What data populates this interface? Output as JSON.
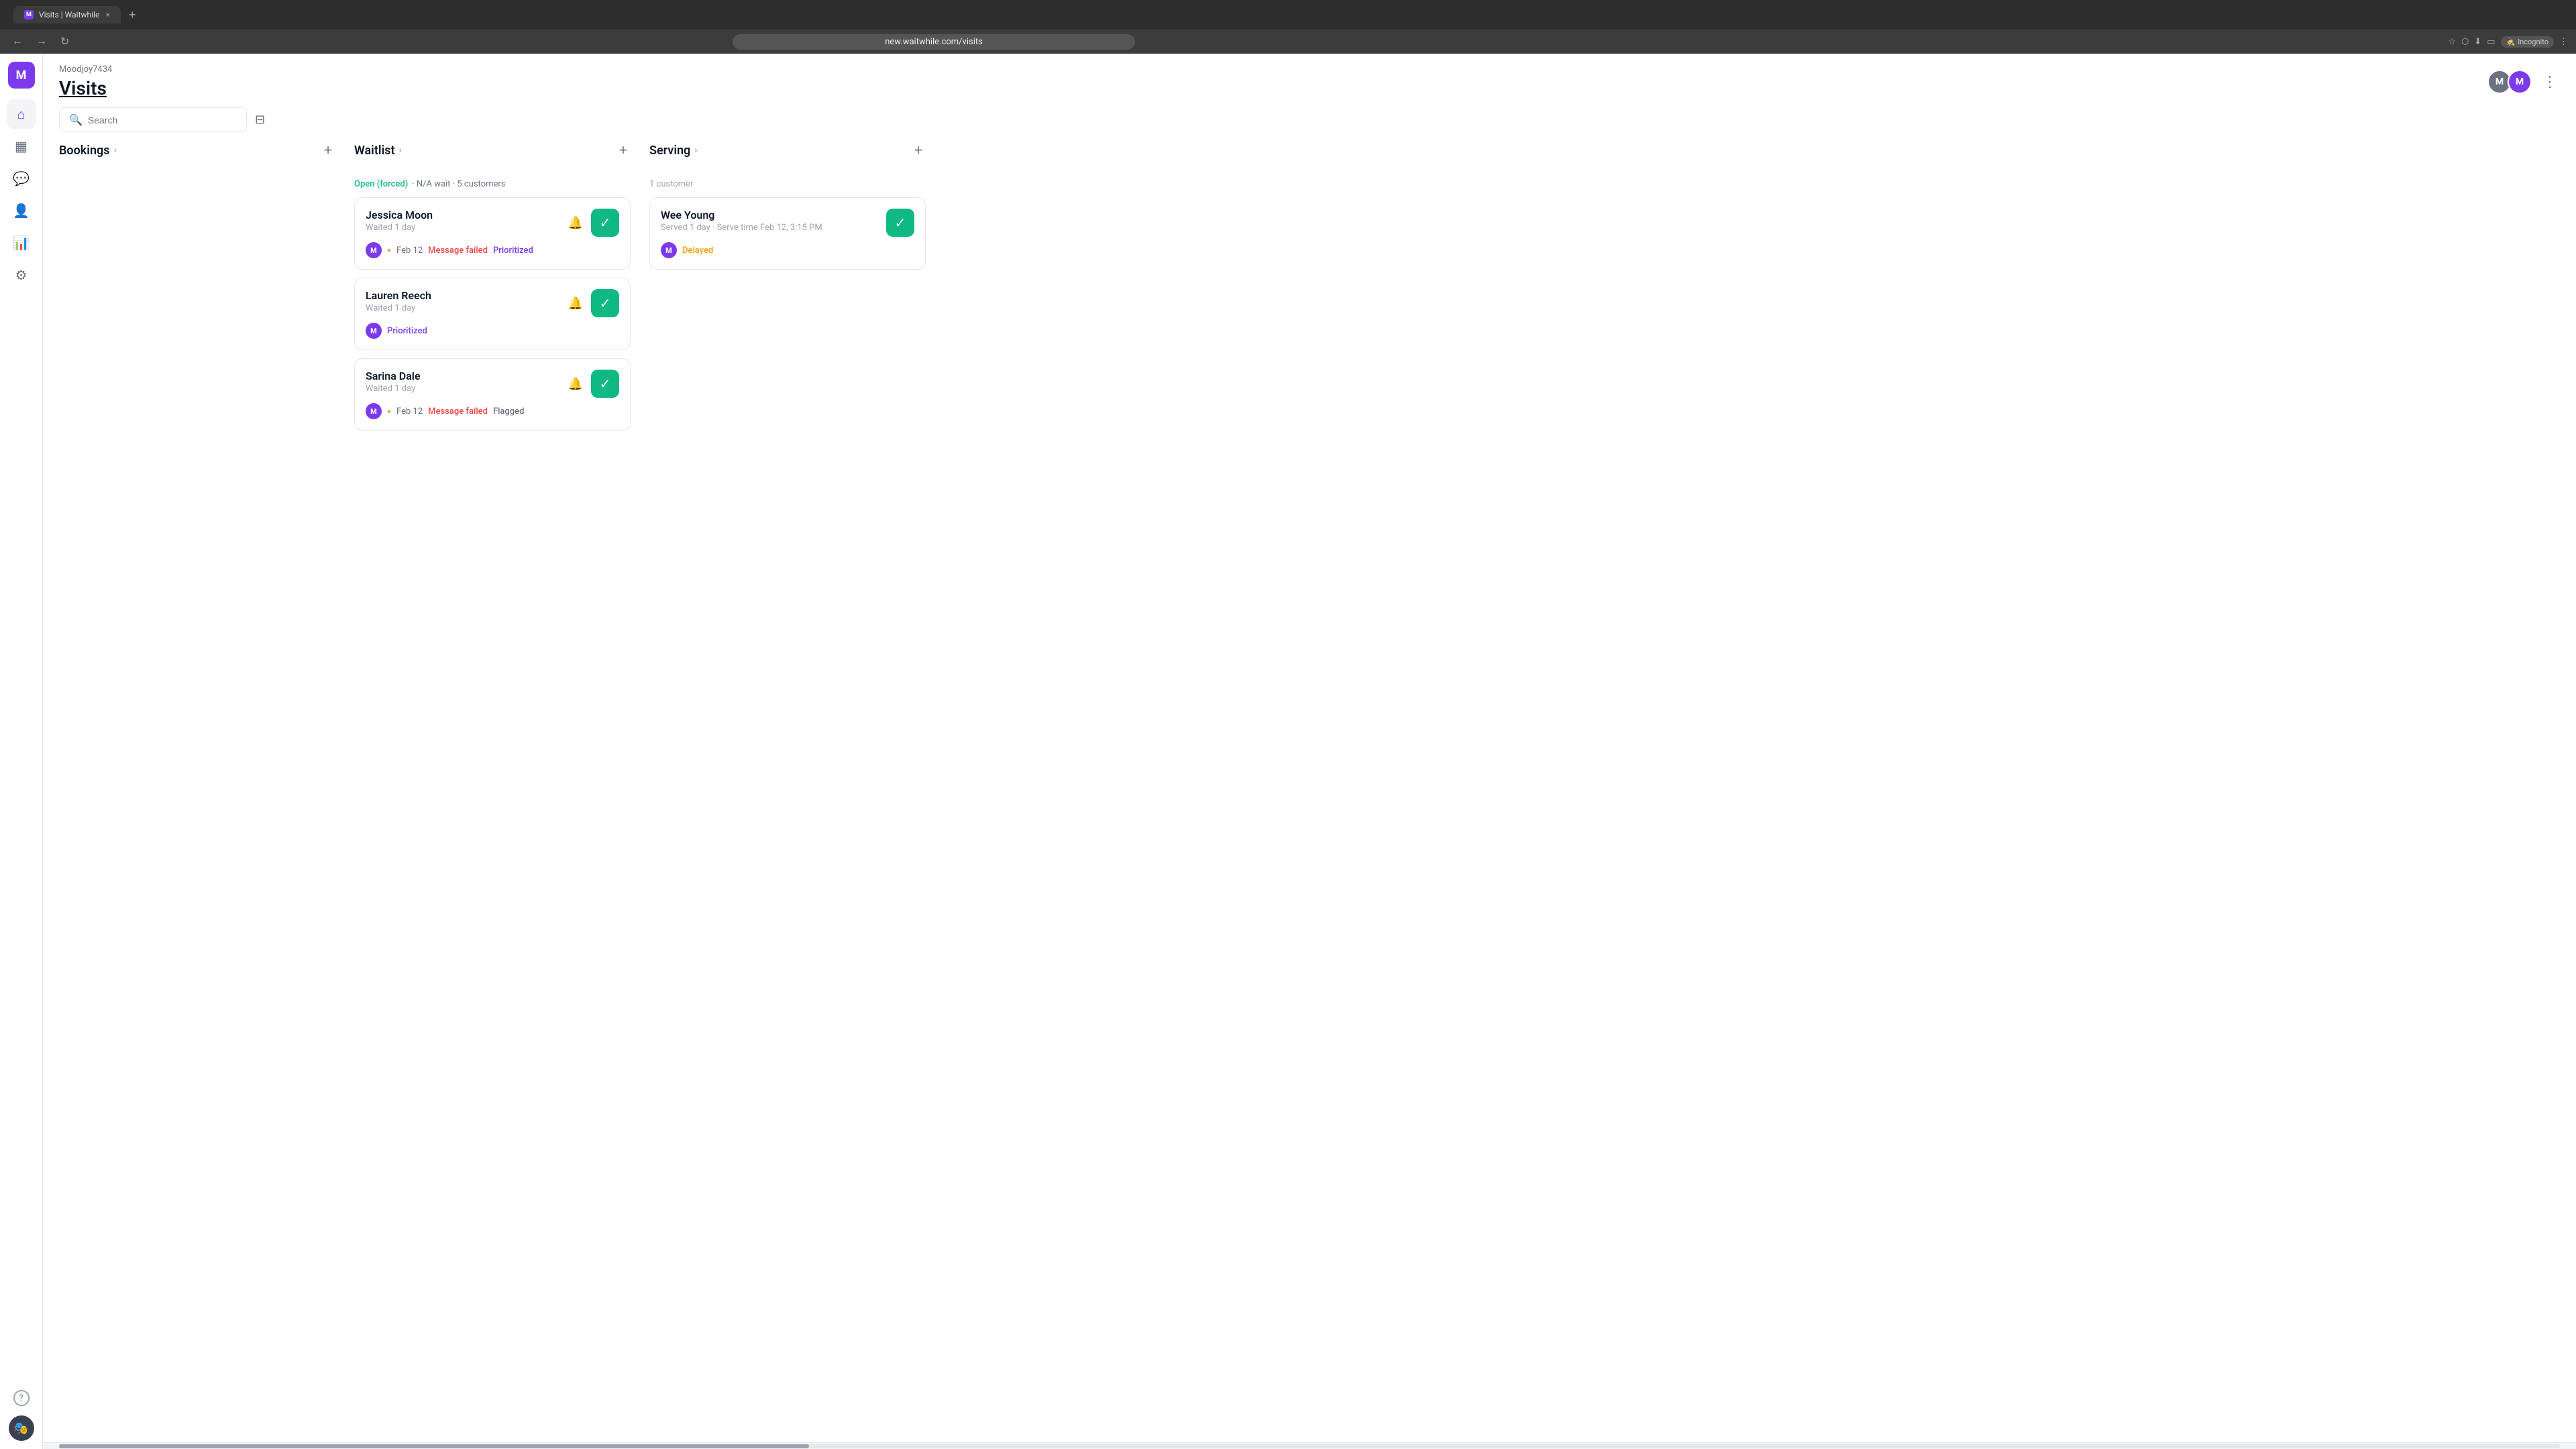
{
  "browser": {
    "tab_favicon": "M",
    "tab_title": "Visits | Waitwhile",
    "tab_close": "×",
    "tab_new": "+",
    "nav_back": "←",
    "nav_forward": "→",
    "nav_refresh": "↻",
    "address": "new.waitwhile.com/visits",
    "incognito_label": "Incognito"
  },
  "sidebar": {
    "logo_letter": "M",
    "items": [
      {
        "icon": "⌂",
        "label": "home-icon",
        "active": true
      },
      {
        "icon": "📅",
        "label": "calendar-icon",
        "active": false
      },
      {
        "icon": "💬",
        "label": "messages-icon",
        "active": false
      },
      {
        "icon": "👤",
        "label": "users-icon",
        "active": false
      },
      {
        "icon": "📊",
        "label": "analytics-icon",
        "active": false
      },
      {
        "icon": "⚙",
        "label": "settings-icon",
        "active": false
      }
    ],
    "help_icon": "?",
    "avatar_text": ""
  },
  "header": {
    "org_name": "Moodjoy7434",
    "page_title": "Visits",
    "avatars": [
      {
        "letter": "M",
        "color": "#6b7280"
      },
      {
        "letter": "M",
        "color": "#7c3aed"
      }
    ],
    "more_icon": "⋮"
  },
  "search": {
    "placeholder": "Search",
    "filter_icon": "⊟"
  },
  "columns": [
    {
      "id": "bookings",
      "title": "Bookings",
      "chevron": "›",
      "add_btn": "+",
      "has_status": false,
      "cards": []
    },
    {
      "id": "waitlist",
      "title": "Waitlist",
      "chevron": "›",
      "add_btn": "+",
      "has_status": true,
      "status_text": "Open (forced)",
      "status_suffix": "· N/A wait · 5 customers",
      "cards": [
        {
          "name": "Jessica Moon",
          "waited": "Waited 1 day",
          "avatar_letter": "M",
          "meta_dot": "●",
          "meta_date": "Feb 12",
          "tags": [
            {
              "label": "Message failed",
              "color": "red"
            },
            {
              "label": "Prioritized",
              "color": "purple"
            }
          ]
        },
        {
          "name": "Lauren Reech",
          "waited": "Waited 1 day",
          "avatar_letter": "M",
          "meta_dot": null,
          "meta_date": null,
          "tags": [
            {
              "label": "Prioritized",
              "color": "purple"
            }
          ]
        },
        {
          "name": "Sarina Dale",
          "waited": "Waited 1 day",
          "avatar_letter": "M",
          "meta_dot": "●",
          "meta_date": "Feb 12",
          "tags": [
            {
              "label": "Message failed",
              "color": "red"
            },
            {
              "label": "Flagged",
              "color": "gray"
            }
          ]
        }
      ]
    },
    {
      "id": "serving",
      "title": "Serving",
      "chevron": "›",
      "add_btn": "+",
      "has_status": false,
      "customer_count": "1 customer",
      "cards": [
        {
          "name": "Wee Young",
          "served": "Served 1 day · Serve time Feb 12, 3:15 PM",
          "avatar_letter": "M",
          "meta_dot": null,
          "meta_date": null,
          "tags": [
            {
              "label": "Delayed",
              "color": "orange"
            }
          ]
        }
      ]
    }
  ],
  "icons": {
    "checkmark": "✓",
    "bell": "🔔",
    "search": "🔍"
  }
}
